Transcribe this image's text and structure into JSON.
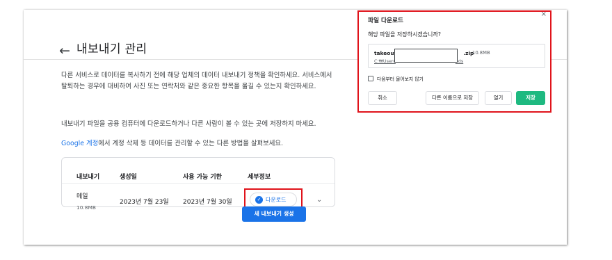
{
  "page": {
    "back_arrow": "←",
    "title": "내보내기 관리",
    "desc1": "다른 서비스로 데이터를 복사하기 전에 해당 업체의 데이터 내보내기 정책을 확인하세요. 서비스에서 탈퇴하는 경우에 대비하여 사진 또는 연락처와 같은 중요한 항목을 옮길 수 있는지 확인하세요.",
    "desc2": "내보내기 파일을 공용 컴퓨터에 다운로드하거나 다른 사람이 볼 수 있는 곳에 저장하지 마세요.",
    "desc3_link": "Google 계정",
    "desc3_rest": "에서 계정 삭제 등 데이터를 관리할 수 있는 다른 방법을 살펴보세요."
  },
  "table": {
    "headers": [
      "내보내기",
      "생성일",
      "사용 가능 기한",
      "세부정보"
    ],
    "row": {
      "name": "메일",
      "size": "10.8MB",
      "created": "2023년 7월 23일",
      "expires": "2023년 7월 30일",
      "download_label": "다운로드",
      "check_icon": "✓",
      "chevron": "⌄"
    }
  },
  "new_export_label": "새 내보내기 생성",
  "dialog": {
    "title": "파일 다운로드",
    "close": "×",
    "question": "해당 파일을 저장하시겠습니까?",
    "file_name_start": "takeout-2",
    "file_name_end": ".zip",
    "file_size": "10.8MB",
    "path_start": "C:₩Userc",
    "path_end": "ads",
    "dont_ask": "다음부터 물어보지 않기",
    "buttons": {
      "cancel": "취소",
      "save_as": "다른 이름으로 저장",
      "open": "열기",
      "save": "저장"
    }
  },
  "colors": {
    "accent_blue": "#1a73e8",
    "save_green": "#1eb980",
    "highlight_red": "#e0131b"
  }
}
